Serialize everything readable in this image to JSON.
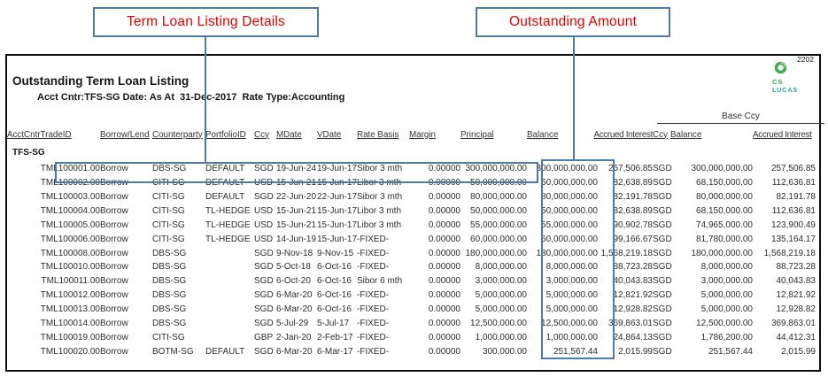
{
  "callouts": {
    "details_label": "Term Loan Listing Details",
    "outstanding_label": "Outstanding Amount"
  },
  "report": {
    "page_number": "2202",
    "logo": {
      "line1": "CS",
      "line2": "LUCAS"
    },
    "title": "Outstanding Term Loan Listing",
    "subtitle": "Acct Cntr:TFS-SG Date: As At  31-Dec-2017  Rate Type:Accounting",
    "base_ccy_group_label": "Base Ccy",
    "columns": [
      "AcctCntrTradeID",
      "Borrow/Lend",
      "Counterparty",
      "PortfolioID",
      "Ccy",
      "MDate",
      "VDate",
      "Rate Basis",
      "Margin",
      "Principal",
      "Balance",
      "Accrued Interest",
      "Ccy",
      "Balance",
      "Accrued Interest"
    ],
    "group_label": "TFS-SG",
    "rows": [
      [
        "TML100001.00",
        "Borrow",
        "DBS-SG",
        "DEFAULT",
        "SGD",
        "19-Jun-24",
        "19-Jun-17",
        "Sibor 3 mth",
        "0.00000",
        "300,000,000.00",
        "300,000,000.00",
        "257,506.85",
        "SGD",
        "300,000,000.00",
        "257,506.85"
      ],
      [
        "TML100002.00",
        "Borrow",
        "CITI-SG",
        "DEFAULT",
        "USD",
        "15-Jun-21",
        "15-Jun-17",
        "Libor 3 mth",
        "0.00000",
        "50,000,000.00",
        "50,000,000.00",
        "82,638.89",
        "SGD",
        "68,150,000.00",
        "112,636.81"
      ],
      [
        "TML100003.00",
        "Borrow",
        "CITI-SG",
        "DEFAULT",
        "SGD",
        "22-Jun-20",
        "22-Jun-17",
        "Sibor 3 mth",
        "0.00000",
        "80,000,000.00",
        "80,000,000.00",
        "82,191.78",
        "SGD",
        "80,000,000.00",
        "82,191.78"
      ],
      [
        "TML100004.00",
        "Borrow",
        "CITI-SG",
        "TL-HEDGE",
        "USD",
        "15-Jun-21",
        "15-Jun-17",
        "Libor 3 mth",
        "0.00000",
        "50,000,000.00",
        "50,000,000.00",
        "82,638.89",
        "SGD",
        "68,150,000.00",
        "112,636.81"
      ],
      [
        "TML100005.00",
        "Borrow",
        "CITI-SG",
        "TL-HEDGE",
        "USD",
        "15-Jun-21",
        "15-Jun-17",
        "Libor 3 mth",
        "0.00000",
        "55,000,000.00",
        "55,000,000.00",
        "90,902.78",
        "SGD",
        "74,965,000.00",
        "123,900.49"
      ],
      [
        "TML100006.00",
        "Borrow",
        "CITI-SG",
        "TL-HEDGE",
        "USD",
        "14-Jun-19",
        "15-Jun-17",
        "-FIXED-",
        "0.00000",
        "60,000,000.00",
        "60,000,000.00",
        "99,166.67",
        "SGD",
        "81,780,000.00",
        "135,164.17"
      ],
      [
        "TML100008.00",
        "Borrow",
        "DBS-SG",
        "",
        "SGD",
        "9-Nov-18",
        "9-Nov-15",
        "-FIXED-",
        "0.00000",
        "180,000,000.00",
        "180,000,000.00",
        "1,568,219.18",
        "SGD",
        "180,000,000.00",
        "1,568,219.18"
      ],
      [
        "TML100010.00",
        "Borrow",
        "DBS-SG",
        "",
        "SGD",
        "5-Oct-18",
        "6-Oct-16",
        "-FIXED-",
        "0.00000",
        "8,000,000.00",
        "8,000,000.00",
        "88,723.28",
        "SGD",
        "8,000,000.00",
        "88,723.28"
      ],
      [
        "TML100011.00",
        "Borrow",
        "DBS-SG",
        "",
        "SGD",
        "6-Oct-20",
        "6-Oct-16",
        "Sibor 6 mth",
        "0.00000",
        "3,000,000.00",
        "3,000,000.00",
        "40,043.83",
        "SGD",
        "3,000,000.00",
        "40,043.83"
      ],
      [
        "TML100012.00",
        "Borrow",
        "DBS-SG",
        "",
        "SGD",
        "6-Mar-20",
        "6-Oct-16",
        "-FIXED-",
        "0.00000",
        "5,000,000.00",
        "5,000,000.00",
        "12,821.92",
        "SGD",
        "5,000,000.00",
        "12,821.92"
      ],
      [
        "TML100013.00",
        "Borrow",
        "DBS-SG",
        "",
        "SGD",
        "6-Mar-20",
        "6-Oct-16",
        "-FIXED-",
        "0.00000",
        "5,000,000.00",
        "5,000,000.00",
        "12,928.82",
        "SGD",
        "5,000,000.00",
        "12,928.82"
      ],
      [
        "TML100014.00",
        "Borrow",
        "DBS-SG",
        "",
        "SGD",
        "5-Jul-29",
        "5-Jul-17",
        "-FIXED-",
        "0.00000",
        "12,500,000.00",
        "12,500,000.00",
        "369,863.01",
        "SGD",
        "12,500,000.00",
        "369,863.01"
      ],
      [
        "TML100019.00",
        "Borrow",
        "CITI-SG",
        "",
        "GBP",
        "2-Jan-20",
        "2-Feb-17",
        "-FIXED-",
        "0.00000",
        "1,000,000.00",
        "1,000,000.00",
        "24,864.13",
        "SGD",
        "1,786,200.00",
        "44,412.31"
      ],
      [
        "TML100020.00",
        "Borrow",
        "BOTM-SG",
        "DEFAULT",
        "SGD",
        "6-Mar-20",
        "6-Mar-17",
        "-FIXED-",
        "0.00000",
        "300,000.00",
        "251,567.44",
        "2,015.99",
        "SGD",
        "251,567.44",
        "2,015.99"
      ]
    ]
  },
  "colors": {
    "accent-blue": "#4d7aa9",
    "callout-red": "#e00000",
    "logo-green": "#3fae49",
    "logo-teal": "#2ba8a0"
  }
}
